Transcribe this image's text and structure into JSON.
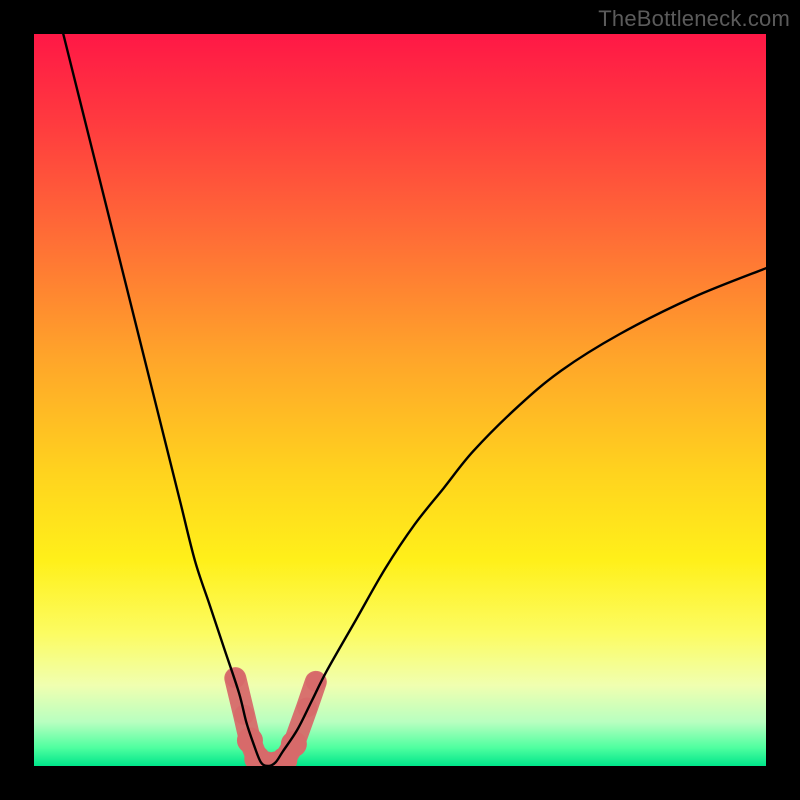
{
  "watermark": "TheBottleneck.com",
  "chart_data": {
    "type": "line",
    "title": "",
    "xlabel": "",
    "ylabel": "",
    "xlim": [
      0,
      100
    ],
    "ylim": [
      0,
      100
    ],
    "background_gradient": {
      "stops": [
        {
          "pos": 0.0,
          "color": "#ff1846"
        },
        {
          "pos": 0.12,
          "color": "#ff3a3f"
        },
        {
          "pos": 0.28,
          "color": "#ff6e36"
        },
        {
          "pos": 0.44,
          "color": "#ffa42a"
        },
        {
          "pos": 0.6,
          "color": "#ffd31e"
        },
        {
          "pos": 0.72,
          "color": "#fff01a"
        },
        {
          "pos": 0.82,
          "color": "#fcfc63"
        },
        {
          "pos": 0.89,
          "color": "#f0ffb0"
        },
        {
          "pos": 0.94,
          "color": "#b8ffc0"
        },
        {
          "pos": 0.975,
          "color": "#4fffa0"
        },
        {
          "pos": 1.0,
          "color": "#00e58a"
        }
      ]
    },
    "series": [
      {
        "name": "bottleneck-curve",
        "color": "#000000",
        "x": [
          4,
          6,
          8,
          10,
          12,
          14,
          16,
          18,
          20,
          22,
          24,
          26,
          28,
          29,
          30,
          31,
          32,
          33,
          34,
          36,
          38,
          40,
          44,
          48,
          52,
          56,
          60,
          66,
          72,
          80,
          90,
          100
        ],
        "y": [
          100,
          92,
          84,
          76,
          68,
          60,
          52,
          44,
          36,
          28,
          22,
          16,
          10,
          6,
          3,
          0.5,
          0,
          0.5,
          2,
          5,
          9,
          13,
          20,
          27,
          33,
          38,
          43,
          49,
          54,
          59,
          64,
          68
        ]
      }
    ],
    "markers": {
      "name": "highlight-band",
      "color": "#d76a6a",
      "points": [
        {
          "x": 27.5,
          "y": 12
        },
        {
          "x": 28.7,
          "y": 7
        },
        {
          "x": 29.5,
          "y": 3.5
        },
        {
          "x": 30.5,
          "y": 1
        },
        {
          "x": 31.8,
          "y": 0.2
        },
        {
          "x": 33.0,
          "y": 0.2
        },
        {
          "x": 34.2,
          "y": 0.8
        },
        {
          "x": 35.5,
          "y": 3
        },
        {
          "x": 37.3,
          "y": 8
        },
        {
          "x": 38.5,
          "y": 11.5
        }
      ]
    }
  }
}
